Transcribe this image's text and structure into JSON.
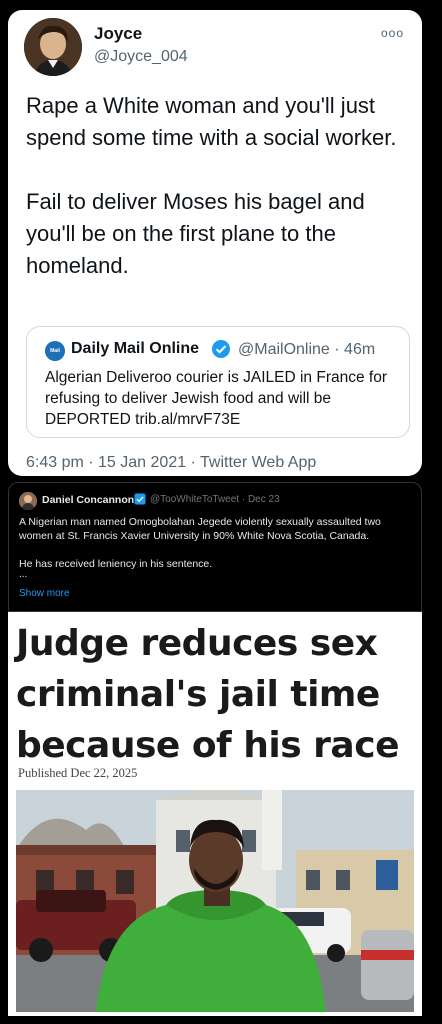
{
  "tweet1": {
    "name": "Joyce",
    "handle": "@Joyce_004",
    "more_icon": "more-dots-icon",
    "text": "Rape a White woman and you'll just spend some time with a social worker.\n\nFail to deliver Moses his bagel and you'll be on the first plane to the homeland.",
    "quote": {
      "logo_text": "Mail Online",
      "name": "Daily Mail Online",
      "verified_icon": "verified-badge-icon",
      "handle": "@MailOnline · 46m",
      "text": "Algerian Deliveroo courier is JAILED in France for refusing to deliver Jewish food and will be DEPORTED trib.al/mrvF73E"
    },
    "timestamp": "6:43 pm · 15 Jan 2021 · Twitter Web App"
  },
  "post2": {
    "name": "Daniel Concannon",
    "verified_icon": "verified-badge-icon",
    "handle": "@TooWhiteToTweet · Dec 23",
    "para1": "A Nigerian man named Omogbolahan Jegede violently sexually assaulted two women at St. Francis Xavier University in 90% White Nova Scotia, Canada.",
    "para2": "He has received leniency in his sentence.",
    "ellipsis": "...",
    "show_more": "Show more"
  },
  "article": {
    "headline": "Judge reduces sex criminal's jail time because of his race",
    "published": "Published Dec 22, 2025",
    "colors": {
      "jacket": "#3fae3a",
      "sky": "#c9d3da"
    }
  }
}
